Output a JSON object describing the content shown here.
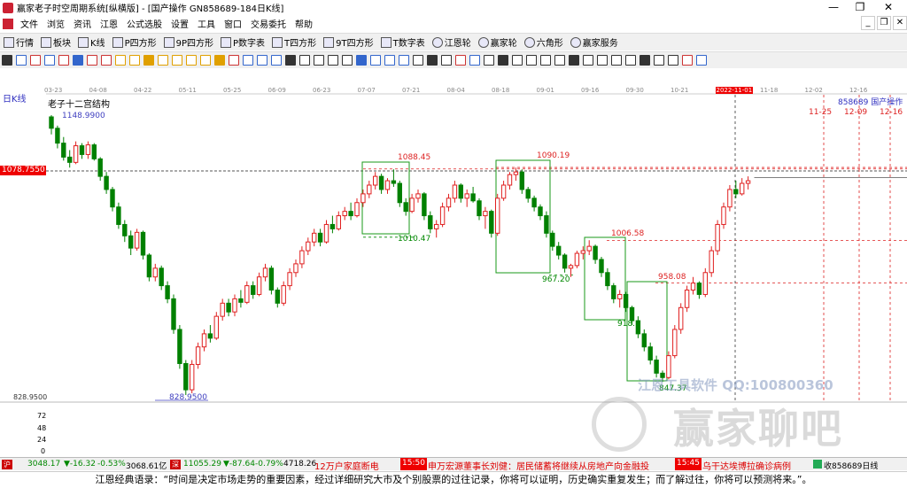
{
  "window": {
    "title": "赢家老子时空周期系统[纵横版] - [国产操作  GN858689-184日K线]",
    "controls": {
      "minimize": "—",
      "maximize": "❐",
      "close": "✕"
    }
  },
  "menu": [
    "文件",
    "浏览",
    "资讯",
    "江恩",
    "公式选股",
    "设置",
    "工具",
    "窗口",
    "交易委托",
    "帮助"
  ],
  "toolbar1": [
    {
      "icon": "hq-icon",
      "label": "行情"
    },
    {
      "icon": "bk-icon",
      "label": "板块"
    },
    {
      "icon": "k-icon",
      "label": "K线"
    },
    {
      "icon": "p-icon",
      "label": "P四方形"
    },
    {
      "icon": "9p-icon",
      "label": "9P四方形"
    },
    {
      "icon": "pn-icon",
      "label": "P数字表"
    },
    {
      "icon": "t-icon",
      "label": "T四方形"
    },
    {
      "icon": "9t-icon",
      "label": "9T四方形"
    },
    {
      "icon": "tn-icon",
      "label": "T数字表"
    },
    {
      "icon": "wheel-icon",
      "label": "江恩轮"
    },
    {
      "icon": "win-wheel-icon",
      "label": "赢家轮"
    },
    {
      "icon": "hexagon-icon",
      "label": "六角形"
    },
    {
      "icon": "service-icon",
      "label": "赢家服务"
    }
  ],
  "chart": {
    "period_label": "日K线",
    "structure_label": "老子十二宫结构",
    "stock_label": "858689  国产操作",
    "current_price_tag": "1078.7550",
    "left_low_axis": "828.9500",
    "volume_axis": [
      "72",
      "48",
      "24",
      "0"
    ],
    "top_right_dates": [
      "11-25",
      "12-09",
      "12-16"
    ],
    "highlight_date": "2022-11-01",
    "date_ticks": [
      "03-23",
      "04-08",
      "04-22",
      "05-11",
      "05-25",
      "06-09",
      "06-23",
      "07-07",
      "07-21",
      "08-04",
      "08-18",
      "09-01",
      "09-16",
      "09-30",
      "10-21",
      "2022-11-01",
      "11-18",
      "12-02",
      "12-16"
    ],
    "annotations": [
      {
        "text": "1148.9900",
        "color": "#4040c0"
      },
      {
        "text": "828.9500",
        "color": "#4040c0"
      },
      {
        "text": "1088.45",
        "color": "#d22"
      },
      {
        "text": "1010.47",
        "color": "#080"
      },
      {
        "text": "1090.19",
        "color": "#d22"
      },
      {
        "text": "967.20",
        "color": "#080"
      },
      {
        "text": "1006.58",
        "color": "#d22"
      },
      {
        "text": "918.",
        "color": "#080"
      },
      {
        "text": "958.08",
        "color": "#d22"
      },
      {
        "text": "847.37",
        "color": "#080"
      }
    ],
    "watermark_small": "江恩工具软件  QQ:100800360",
    "watermark_big": "赢家聊吧"
  },
  "chart_data": {
    "type": "candlestick",
    "series_name": "858689 国产操作 日K线",
    "x_range": [
      "2022-03-23",
      "2022-11-07"
    ],
    "y_range": [
      828.95,
      1148.99
    ],
    "key_levels": [
      1148.99,
      1088.45,
      1010.47,
      1090.19,
      967.2,
      1006.58,
      958.08,
      847.37,
      828.95
    ],
    "last_price": 1078.755,
    "candles": [
      [
        1148,
        1150,
        1128,
        1135
      ],
      [
        1135,
        1138,
        1112,
        1118
      ],
      [
        1118,
        1125,
        1098,
        1102
      ],
      [
        1102,
        1110,
        1090,
        1096
      ],
      [
        1096,
        1120,
        1094,
        1115
      ],
      [
        1115,
        1118,
        1100,
        1105
      ],
      [
        1105,
        1120,
        1100,
        1116
      ],
      [
        1116,
        1118,
        1098,
        1100
      ],
      [
        1100,
        1102,
        1075,
        1080
      ],
      [
        1080,
        1085,
        1060,
        1065
      ],
      [
        1065,
        1068,
        1040,
        1045
      ],
      [
        1045,
        1050,
        1020,
        1025
      ],
      [
        1025,
        1030,
        1005,
        1012
      ],
      [
        1012,
        1018,
        990,
        998
      ],
      [
        998,
        1020,
        995,
        1016
      ],
      [
        1016,
        1018,
        985,
        990
      ],
      [
        990,
        992,
        960,
        965
      ],
      [
        965,
        980,
        960,
        975
      ],
      [
        975,
        978,
        950,
        955
      ],
      [
        955,
        960,
        935,
        940
      ],
      [
        940,
        945,
        900,
        905
      ],
      [
        905,
        910,
        860,
        866
      ],
      [
        866,
        870,
        830,
        836
      ],
      [
        836,
        870,
        832,
        865
      ],
      [
        865,
        890,
        860,
        885
      ],
      [
        885,
        905,
        880,
        900
      ],
      [
        900,
        910,
        890,
        895
      ],
      [
        895,
        925,
        893,
        920
      ],
      [
        920,
        940,
        915,
        935
      ],
      [
        935,
        940,
        920,
        925
      ],
      [
        925,
        945,
        920,
        940
      ],
      [
        940,
        950,
        930,
        936
      ],
      [
        936,
        960,
        934,
        955
      ],
      [
        955,
        960,
        940,
        945
      ],
      [
        945,
        970,
        943,
        965
      ],
      [
        965,
        980,
        960,
        975
      ],
      [
        975,
        978,
        945,
        950
      ],
      [
        950,
        953,
        930,
        935
      ],
      [
        935,
        960,
        932,
        955
      ],
      [
        955,
        975,
        950,
        970
      ],
      [
        970,
        985,
        965,
        980
      ],
      [
        980,
        1000,
        975,
        995
      ],
      [
        995,
        1010,
        990,
        1005
      ],
      [
        1005,
        1020,
        1000,
        1015
      ],
      [
        1015,
        1020,
        1000,
        1005
      ],
      [
        1005,
        1030,
        1003,
        1025
      ],
      [
        1025,
        1035,
        1015,
        1020
      ],
      [
        1020,
        1040,
        1018,
        1035
      ],
      [
        1035,
        1045,
        1030,
        1040
      ],
      [
        1040,
        1050,
        1030,
        1035
      ],
      [
        1035,
        1055,
        1033,
        1050
      ],
      [
        1050,
        1065,
        1045,
        1060
      ],
      [
        1060,
        1075,
        1055,
        1070
      ],
      [
        1070,
        1085,
        1065,
        1080
      ],
      [
        1080,
        1083,
        1060,
        1065
      ],
      [
        1065,
        1078,
        1060,
        1075
      ],
      [
        1075,
        1088,
        1068,
        1072
      ],
      [
        1072,
        1075,
        1045,
        1050
      ],
      [
        1050,
        1055,
        1035,
        1040
      ],
      [
        1040,
        1060,
        1038,
        1055
      ],
      [
        1055,
        1065,
        1050,
        1060
      ],
      [
        1060,
        1062,
        1030,
        1035
      ],
      [
        1035,
        1040,
        1015,
        1020
      ],
      [
        1020,
        1030,
        1010,
        1025
      ],
      [
        1025,
        1050,
        1022,
        1045
      ],
      [
        1045,
        1060,
        1040,
        1055
      ],
      [
        1055,
        1075,
        1050,
        1070
      ],
      [
        1070,
        1072,
        1050,
        1055
      ],
      [
        1055,
        1065,
        1045,
        1060
      ],
      [
        1060,
        1068,
        1050,
        1052
      ],
      [
        1052,
        1055,
        1030,
        1035
      ],
      [
        1035,
        1045,
        1020,
        1040
      ],
      [
        1040,
        1042,
        1010,
        1015
      ],
      [
        1015,
        1060,
        1012,
        1055
      ],
      [
        1055,
        1075,
        1052,
        1070
      ],
      [
        1070,
        1085,
        1065,
        1082
      ],
      [
        1082,
        1090,
        1075,
        1085
      ],
      [
        1085,
        1088,
        1060,
        1065
      ],
      [
        1065,
        1068,
        1050,
        1055
      ],
      [
        1055,
        1058,
        1040,
        1045
      ],
      [
        1045,
        1048,
        1030,
        1035
      ],
      [
        1035,
        1040,
        1010,
        1015
      ],
      [
        1015,
        1018,
        995,
        1000
      ],
      [
        1000,
        1005,
        985,
        990
      ],
      [
        990,
        992,
        970,
        975
      ],
      [
        975,
        980,
        965,
        978
      ],
      [
        978,
        995,
        975,
        992
      ],
      [
        992,
        1000,
        985,
        995
      ],
      [
        995,
        1007,
        990,
        1000
      ],
      [
        1000,
        1002,
        980,
        985
      ],
      [
        985,
        988,
        965,
        970
      ],
      [
        970,
        975,
        950,
        955
      ],
      [
        955,
        958,
        935,
        940
      ],
      [
        940,
        950,
        930,
        945
      ],
      [
        945,
        948,
        925,
        930
      ],
      [
        930,
        932,
        910,
        915
      ],
      [
        915,
        920,
        895,
        900
      ],
      [
        900,
        905,
        880,
        885
      ],
      [
        885,
        890,
        865,
        870
      ],
      [
        870,
        875,
        850,
        855
      ],
      [
        855,
        858,
        845,
        850
      ],
      [
        850,
        880,
        848,
        875
      ],
      [
        875,
        910,
        872,
        905
      ],
      [
        905,
        935,
        900,
        930
      ],
      [
        930,
        955,
        925,
        950
      ],
      [
        950,
        965,
        945,
        958
      ],
      [
        958,
        960,
        940,
        945
      ],
      [
        945,
        975,
        942,
        970
      ],
      [
        970,
        1000,
        965,
        995
      ],
      [
        995,
        1030,
        990,
        1025
      ],
      [
        1025,
        1050,
        1020,
        1045
      ],
      [
        1045,
        1070,
        1040,
        1065
      ],
      [
        1065,
        1075,
        1055,
        1060
      ],
      [
        1060,
        1078,
        1058,
        1072
      ],
      [
        1072,
        1080,
        1065,
        1075
      ]
    ]
  },
  "status": {
    "sh_index": "3048.17",
    "sh_change": "▼-16.32",
    "sh_pct": "-0.53%",
    "sh_amount": "3068.61亿",
    "sz_index": "11055.29",
    "sz_change": "▼-87.64",
    "sz_pct": "-0.79%",
    "sz_amount": "4718.26",
    "news1": "12万户家庭断电",
    "time1": "15:50",
    "news2": "申万宏源董事长刘健：居民储蓄将继续从房地产向金融投",
    "time2": "15:45",
    "news3": "乌干达埃博拉确诊病例",
    "right_label": "收858689日线"
  },
  "quote": "江恩经典语录：“时间是决定市场走势的重要因素，经过详细研究大市及个别股票的过往记录，你将可以证明，历史确实重复发生；而了解过往，你将可以预测将来。”。"
}
